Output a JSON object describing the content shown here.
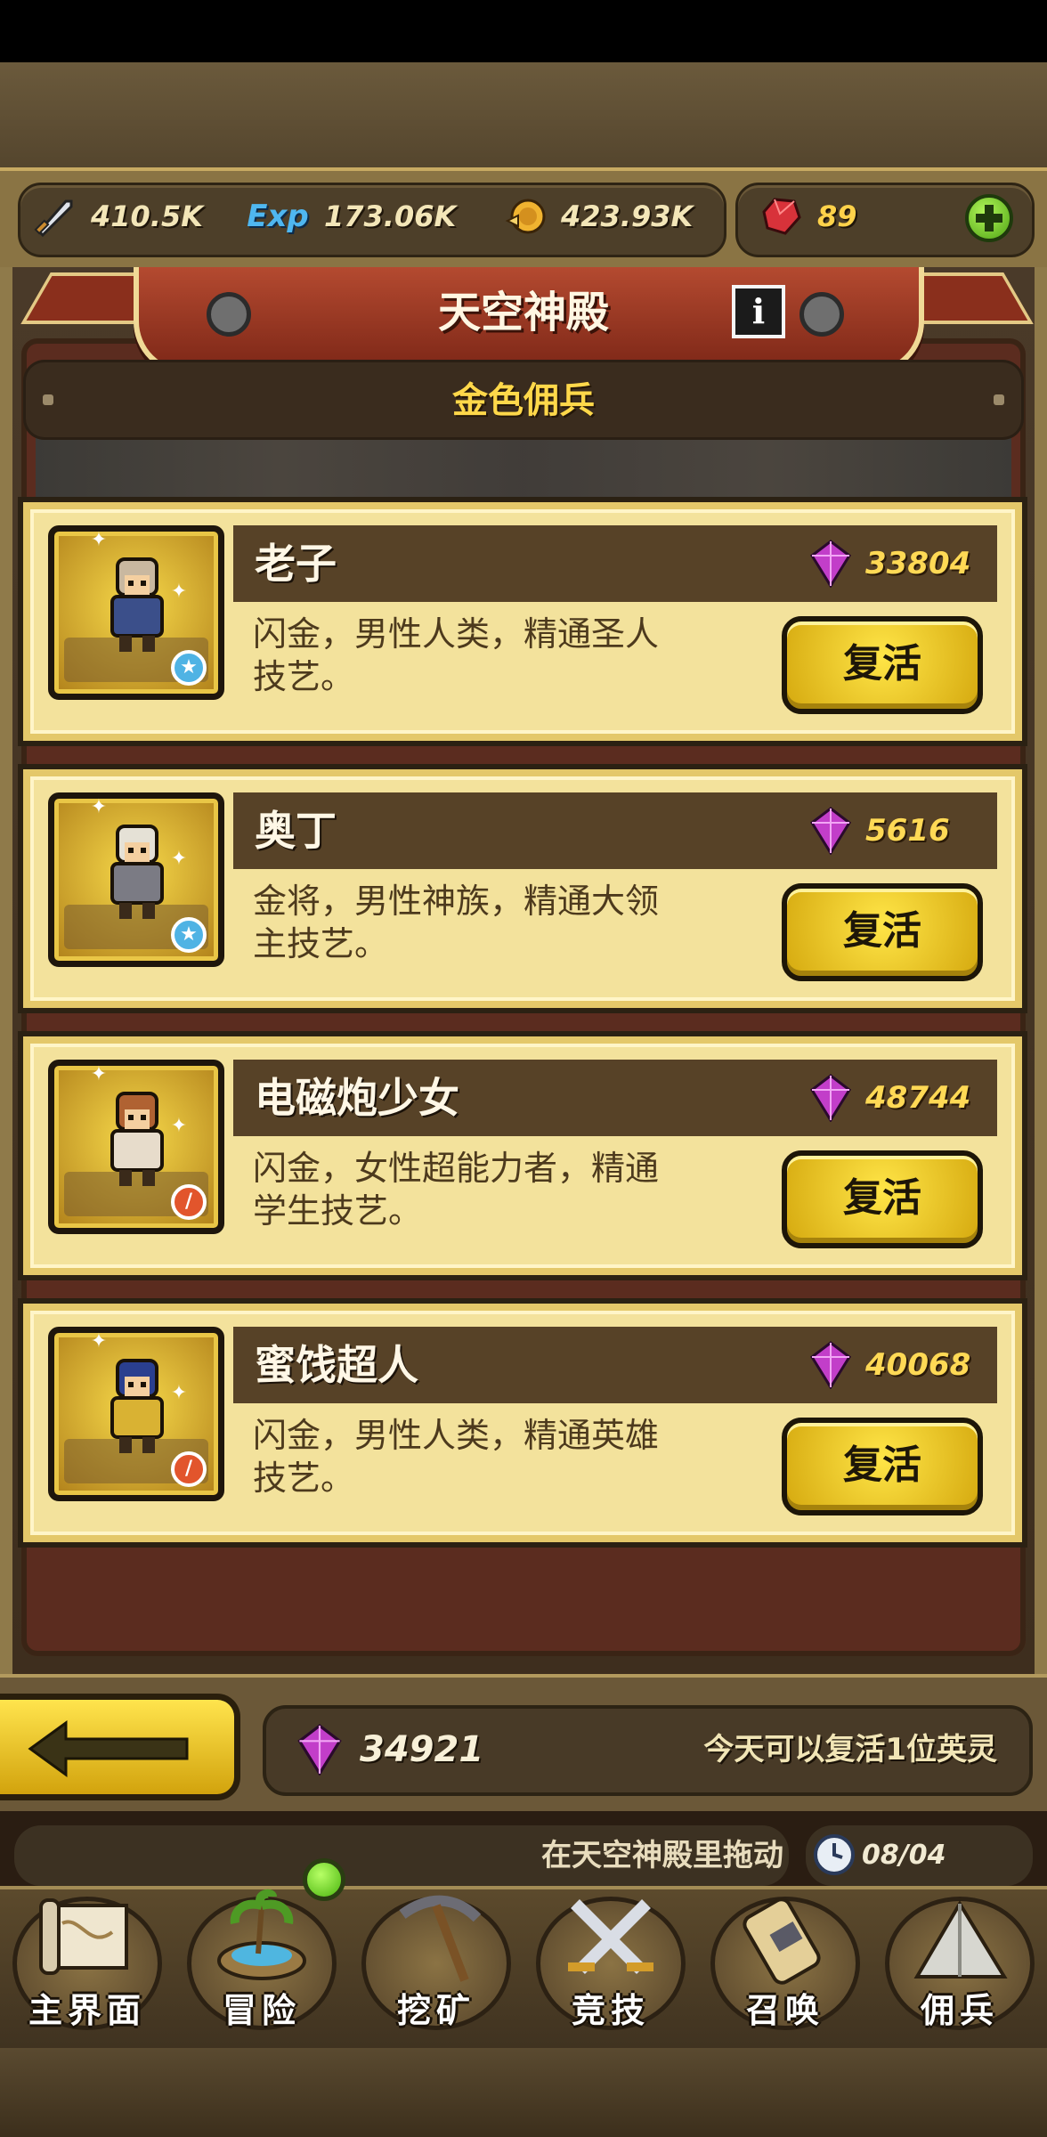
{
  "resources": {
    "attack": "410.5K",
    "exp_label": "Exp",
    "exp": "173.06K",
    "gold": "423.93K",
    "ruby": "89"
  },
  "header": {
    "title": "天空神殿",
    "info_glyph": "i",
    "subtitle": "金色佣兵"
  },
  "heroes": [
    {
      "name": "老子",
      "price": "33804",
      "desc_line1": "闪金，男性人类，精通圣人",
      "desc_line2": "技艺。",
      "button": "复活",
      "badge": "star-icon",
      "hair": "#c9b8a0",
      "body": "#3b4f8a"
    },
    {
      "name": "奥丁",
      "price": "5616",
      "desc_line1": "金将，男性神族，精通大领",
      "desc_line2": "主技艺。",
      "button": "复活",
      "badge": "star-icon",
      "hair": "#e5e1d6",
      "body": "#7b7b84"
    },
    {
      "name": "电磁炮少女",
      "price": "48744",
      "desc_line1": "闪金，女性超能力者，精通",
      "desc_line2": "学生技艺。",
      "button": "复活",
      "badge": "sword-icon",
      "hair": "#b06232",
      "body": "#e7dccb"
    },
    {
      "name": "蜜饯超人",
      "price": "40068",
      "desc_line1": "闪金，男性人类，精通英雄",
      "desc_line2": "技艺。",
      "button": "复活",
      "badge": "sword-icon",
      "hair": "#2a3f8f",
      "body": "#d9b233"
    }
  ],
  "footer": {
    "gem_total": "34921",
    "revive_note": "今天可以复活1位英灵",
    "ticker": "在天空神殿里拖动",
    "clock": "08/04 00:18"
  },
  "nav": [
    {
      "label": "主界面",
      "icon": "map-scroll-icon"
    },
    {
      "label": "冒险",
      "icon": "island-icon"
    },
    {
      "label": "挖矿",
      "icon": "pickaxe-icon"
    },
    {
      "label": "竞技",
      "icon": "crossed-swords-icon"
    },
    {
      "label": "召唤",
      "icon": "summon-scroll-icon"
    },
    {
      "label": "佣兵",
      "icon": "tent-icon"
    }
  ],
  "colors": {
    "gold_text": "#ffd955",
    "button_yellow": "#ffe547",
    "banner_red": "#b44a30",
    "gem_purple": "#c23ec9"
  }
}
